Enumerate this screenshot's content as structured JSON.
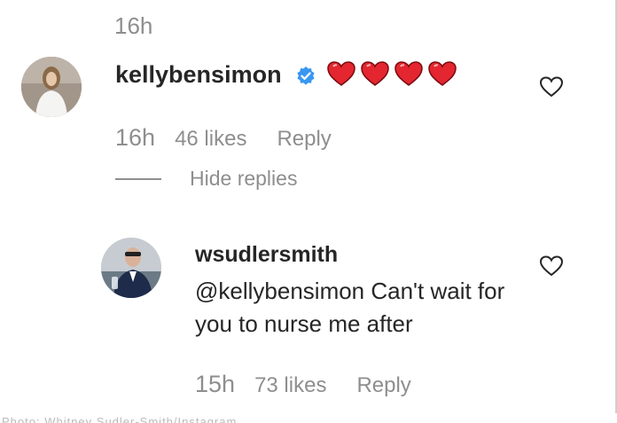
{
  "top_time": "16h",
  "comment1": {
    "username": "kellybensimon",
    "hearts_count": 4,
    "time": "16h",
    "likes": "46 likes",
    "reply_label": "Reply",
    "hide_replies_label": "Hide replies"
  },
  "comment2": {
    "username": "wsudlersmith",
    "text": "@kellybensimon Can't wait for you to nurse me after",
    "time": "15h",
    "likes": "73 likes",
    "reply_label": "Reply"
  },
  "footer_caption": "Photo: Whitney Sudler-Smith/Instagram",
  "colors": {
    "verified": "#3897f0",
    "heart_red": "#ed4956",
    "muted_text": "#8e8e8e"
  }
}
